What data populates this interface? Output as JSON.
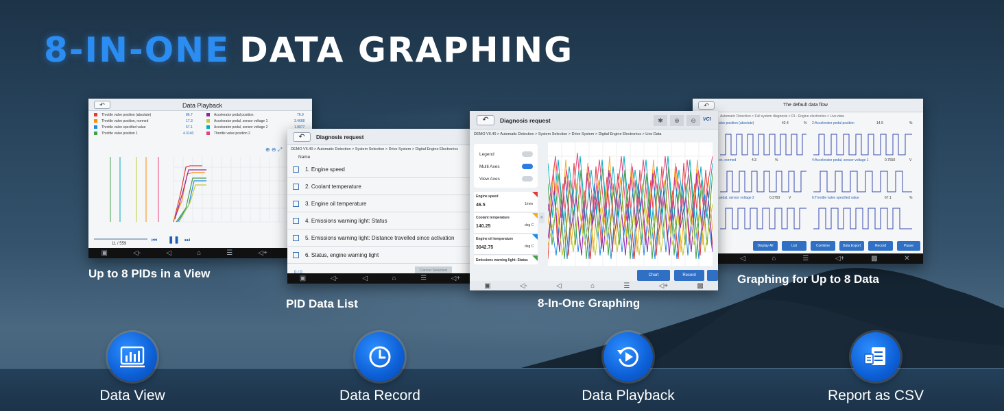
{
  "headline": {
    "accent": "8-IN-ONE",
    "rest": "DATA GRAPHING"
  },
  "screen1": {
    "title": "Data Playback",
    "pids_left": [
      {
        "name": "Throttle valve position (absolute)",
        "value": "86.7",
        "color": "#e53935"
      },
      {
        "name": "Throttle valve position, normed",
        "value": "17.3",
        "color": "#fb8c00"
      },
      {
        "name": "Throttle valve specified value",
        "value": "67.1",
        "color": "#1e88e5"
      },
      {
        "name": "Throttle valve position 1",
        "value": "4.3140",
        "color": "#43a047"
      }
    ],
    "pids_right": [
      {
        "name": "Accelerator pedal position",
        "value": "76.9",
        "color": "#8e24aa"
      },
      {
        "name": "Accelerator pedal, sensor voltage 1",
        "value": "3.4668",
        "color": "#c0ca33"
      },
      {
        "name": "Accelerator pedal, sensor voltage 2",
        "value": "1.9077",
        "color": "#00acc1"
      },
      {
        "name": "Throttle valve position 2",
        "value": "",
        "color": "#ec407a"
      }
    ],
    "frame": "11 / 559"
  },
  "screen2": {
    "title": "Diagnosis request",
    "breadcrumb": "DEMO V6.40 > Automatic Detection > System Selection > Drive System > Digital Engine Electronics",
    "column": "Name",
    "rows": [
      "1. Engine speed",
      "2. Coolant temperature",
      "3. Engine oil temperature",
      "4. Emissions warning light: Status",
      "5. Emissions warning light: Distance travelled since activation",
      "6. Status, engine warning light"
    ],
    "page": "0 / 0",
    "cancel": "Cancel Selected"
  },
  "screen3": {
    "title": "Diagnosis request",
    "breadcrumb": "DEMO V6.40 > Automatic Detection > System Selection > Drive System > Digital Engine Electronics > Live Data",
    "toggles": [
      {
        "label": "Legend",
        "on": false
      },
      {
        "label": "Multi Axes",
        "on": true
      },
      {
        "label": "View Axes",
        "on": false
      }
    ],
    "readings": [
      {
        "name": "Engine speed",
        "value": "46.5",
        "unit": "1/min",
        "color": "#e53935"
      },
      {
        "name": "Coolant temperature",
        "value": "140.25",
        "unit": "deg C",
        "color": "#f9a825"
      },
      {
        "name": "Engine oil temperature",
        "value": "3042.75",
        "unit": "deg C",
        "color": "#1e88e5"
      },
      {
        "name": "Emissions warning light: Status",
        "value": "",
        "unit": "",
        "color": "#43a047"
      }
    ],
    "vci": "VCI",
    "buttons": [
      "Chart",
      "Record"
    ]
  },
  "screen4": {
    "title": "The default data flow",
    "breadcrumb": "Automatic Detection > Full system diagnosis > 01 - Engine electronics > Live data",
    "cells": [
      {
        "label": "alve position (absolute)",
        "value": "42.4",
        "unit": "%"
      },
      {
        "label": "2:Accelerator pedal position",
        "value": "14.9",
        "unit": "%"
      },
      {
        "label": "on, normed",
        "value": "4.3",
        "unit": "%"
      },
      {
        "label": "4:Accelerator pedal, sensor voltage 1",
        "value": "0.7550",
        "unit": "V"
      },
      {
        "label": "pedal, sensor voltage 2",
        "value": "0.3793",
        "unit": "V"
      },
      {
        "label": "6:Throttle valve specified value",
        "value": "67.1",
        "unit": "%"
      }
    ],
    "buttons": [
      "Display All",
      "List",
      "Combine",
      "Data Export",
      "Record",
      "Pause"
    ]
  },
  "captions": {
    "c1": "Up to 8 PIDs in a View",
    "c2": "PID Data List",
    "c3": "8-In-One Graphing",
    "c4": "Graphing for Up to 8 Data"
  },
  "features": [
    {
      "label": "Data View",
      "icon": "bar-chart-icon"
    },
    {
      "label": "Data Record",
      "icon": "clock-icon"
    },
    {
      "label": "Data Playback",
      "icon": "replay-icon"
    },
    {
      "label": "Report as CSV",
      "icon": "report-icon"
    }
  ]
}
